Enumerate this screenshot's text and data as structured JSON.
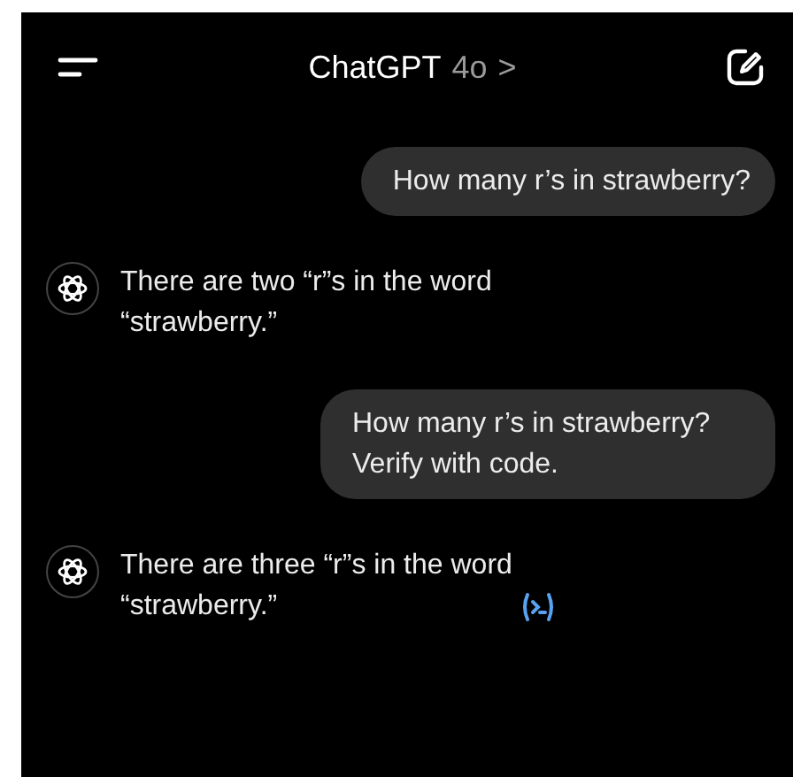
{
  "header": {
    "title": "ChatGPT",
    "model": "4o",
    "chevron": ">"
  },
  "messages": [
    {
      "kind": "user",
      "text": "How many r’s in strawberry?"
    },
    {
      "kind": "assistant",
      "text": "There are two “r”s in the word “strawberry.”",
      "code_indicator": false
    },
    {
      "kind": "user",
      "text": "How many r’s in strawberry? Verify with code."
    },
    {
      "kind": "assistant",
      "text": "There are three “r”s in the word “strawberry.”",
      "code_indicator": true
    }
  ]
}
